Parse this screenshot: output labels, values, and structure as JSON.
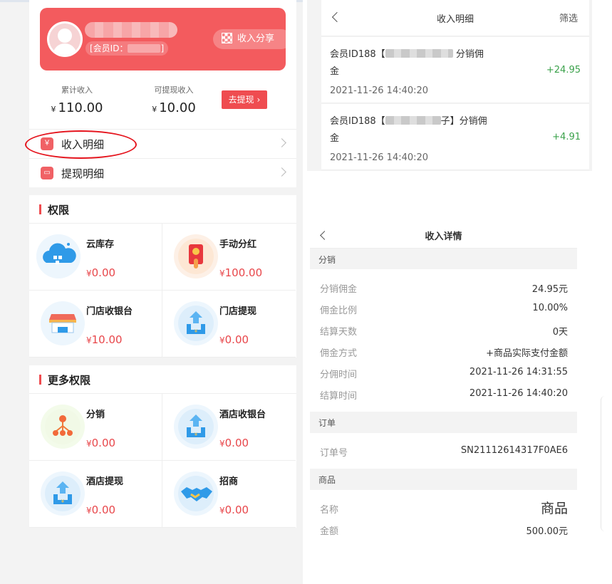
{
  "member": {
    "id_label": "[会员ID：",
    "id_suffix": "]",
    "share_label": "收入分享"
  },
  "stats": [
    {
      "label": "累计收入",
      "currency": "¥",
      "value": "110.00"
    },
    {
      "label": "可提现收入",
      "currency": "¥",
      "value": "10.00"
    }
  ],
  "withdraw_button": "去提现",
  "menu": [
    {
      "label": "收入明细",
      "icon": "money-bag-icon"
    },
    {
      "label": "提现明细",
      "icon": "wallet-icon"
    }
  ],
  "permissions": {
    "title": "权限",
    "items": [
      {
        "name": "云库存",
        "currency": "¥",
        "value": "0.00",
        "icon": "cloud-stock-icon"
      },
      {
        "name": "手动分红",
        "currency": "¥",
        "value": "100.00",
        "icon": "red-envelope-icon"
      },
      {
        "name": "门店收银台",
        "currency": "¥",
        "value": "10.00",
        "icon": "store-cashier-icon"
      },
      {
        "name": "门店提现",
        "currency": "¥",
        "value": "0.00",
        "icon": "withdraw-upload-icon"
      }
    ]
  },
  "more_permissions": {
    "title": "更多权限",
    "items": [
      {
        "name": "分销",
        "currency": "¥",
        "value": "0.00",
        "icon": "distribution-tree-icon"
      },
      {
        "name": "酒店收银台",
        "currency": "¥",
        "value": "0.00",
        "icon": "withdraw-upload-icon"
      },
      {
        "name": "酒店提现",
        "currency": "¥",
        "value": "0.00",
        "icon": "withdraw-upload-icon"
      },
      {
        "name": "招商",
        "currency": "¥",
        "value": "0.00",
        "icon": "handshake-icon"
      }
    ]
  },
  "income_list": {
    "title": "收入明细",
    "filter": "筛选",
    "items": [
      {
        "title_prefix": "会员ID188【",
        "title_suffix": "分销佣",
        "title_line2": "金",
        "date": "2021-11-26 14:40:20",
        "amount": "+24.95"
      },
      {
        "title_prefix": "会员ID188【",
        "title_suffix": "子】分销佣",
        "title_line2": "金",
        "date": "2021-11-26 14:40:20",
        "amount": "+4.91"
      }
    ]
  },
  "income_detail": {
    "title": "收入详情",
    "groups": [
      {
        "head": "分销",
        "rows": [
          {
            "k": "分销佣金",
            "v": "24.95元"
          },
          {
            "k": "佣金比例",
            "v": "10.00%"
          },
          {
            "k": "结算天数",
            "v": "0天"
          },
          {
            "k": "佣金方式",
            "v": "+商品实际支付金额"
          },
          {
            "k": "分佣时间",
            "v": "2021-11-26 14:31:55"
          },
          {
            "k": "结算时间",
            "v": "2021-11-26 14:40:20"
          }
        ]
      },
      {
        "head": "订单",
        "rows": [
          {
            "k": "订单号",
            "v": "SN21112614317F0AE6"
          }
        ]
      },
      {
        "head": "商品",
        "rows": [
          {
            "k": "名称",
            "v": "商品"
          },
          {
            "k": "金额",
            "v": "500.00元"
          }
        ]
      }
    ]
  },
  "colors": {
    "brand_red": "#f35b5e",
    "price_red": "#e8464a",
    "income_green": "#3aa14a"
  }
}
